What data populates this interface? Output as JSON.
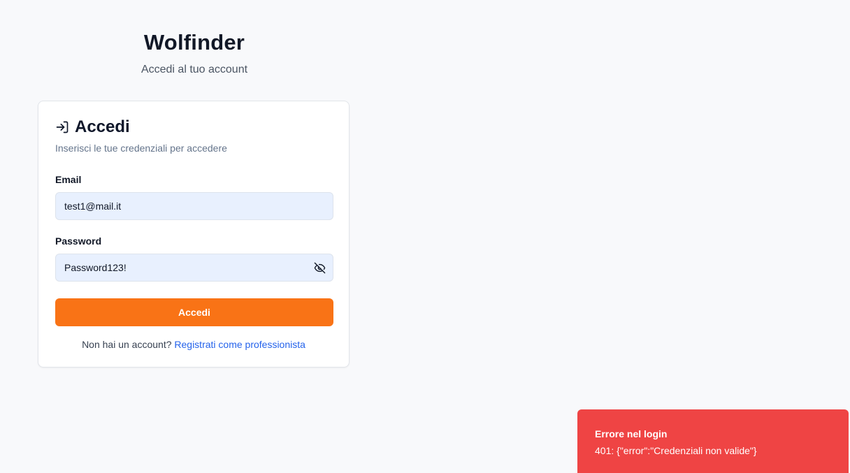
{
  "brand": {
    "title": "Wolfinder",
    "subtitle": "Accedi al tuo account"
  },
  "card": {
    "icon": "login-icon",
    "title": "Accedi",
    "description": "Inserisci le tue credenziali per accedere"
  },
  "form": {
    "email_label": "Email",
    "email_value": "test1@mail.it",
    "password_label": "Password",
    "password_value": "Password123!",
    "password_toggle_icon": "eye-off-icon",
    "submit_label": "Accedi",
    "submit_color": "#f97316"
  },
  "footer": {
    "prompt": "Non hai un account?",
    "register_link": "Registrati come professionista"
  },
  "toast": {
    "title": "Errore nel login",
    "message": "401: {\"error\":\"Credenziali non valide\"}",
    "color": "#ef4444"
  }
}
